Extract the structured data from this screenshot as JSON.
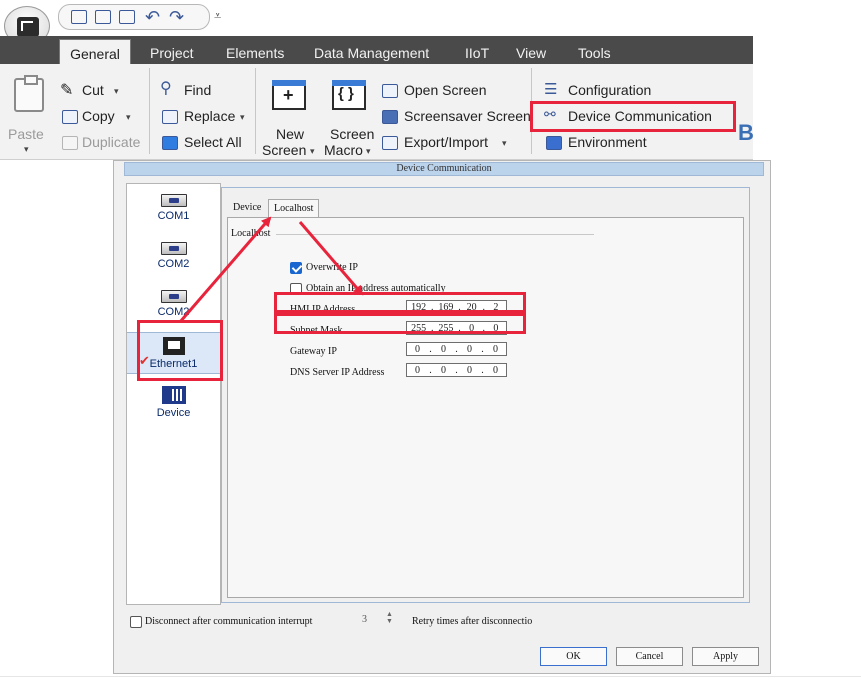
{
  "ribbon": {
    "tabs": [
      "General",
      "Project",
      "Elements",
      "Data Management",
      "IIoT",
      "View",
      "Tools"
    ],
    "active_tab": "General",
    "clipboard": {
      "paste": "Paste",
      "cut": "Cut",
      "copy": "Copy",
      "duplicate": "Duplicate"
    },
    "editing": {
      "find": "Find",
      "replace": "Replace",
      "select_all": "Select All"
    },
    "screen": {
      "new_screen_1": "New",
      "new_screen_2": "Screen",
      "screen_macro_1": "Screen",
      "screen_macro_2": "Macro",
      "open_screen": "Open Screen",
      "screensaver": "Screensaver Screen",
      "export_import": "Export/Import"
    },
    "settings": {
      "configuration": "Configuration",
      "device_communication": "Device Communication",
      "environment": "Environment"
    },
    "extra_glyph": "B",
    "caret": "▾",
    "qat_more": "⩡"
  },
  "dialog": {
    "title": "Device Communication",
    "devices": [
      {
        "label": "COM1"
      },
      {
        "label": "COM2"
      },
      {
        "label": "COM2"
      },
      {
        "label": "Ethernet1",
        "selected": true
      },
      {
        "label": "Device"
      }
    ],
    "selected_mark": "✔",
    "tabs": {
      "device": "Device",
      "localhost": "Localhost"
    },
    "section_title": "Localhost",
    "overwrite_ip": {
      "label": "Overwrite IP",
      "checked": true
    },
    "obtain_ip": {
      "label": "Obtain an IP address automatically",
      "checked": false
    },
    "fields": [
      {
        "label": "HMI IP Address",
        "octets": [
          "192",
          "169",
          "20",
          "2"
        ]
      },
      {
        "label": "Subnet Mask",
        "octets": [
          "255",
          "255",
          "0",
          "0"
        ]
      },
      {
        "label": "Gateway IP",
        "octets": [
          "0",
          "0",
          "0",
          "0"
        ]
      },
      {
        "label": "DNS Server IP Address",
        "octets": [
          "0",
          "0",
          "0",
          "0"
        ]
      }
    ],
    "ip_separator": ".",
    "disconnect": {
      "label": "Disconnect after communication interrupt",
      "checked": false
    },
    "retry_value": "3",
    "spin_up": "▲",
    "spin_down": "▼",
    "retry_label": "Retry times after disconnectio",
    "buttons": {
      "ok": "OK",
      "cancel": "Cancel",
      "apply": "Apply"
    }
  },
  "annotation_color": "#e8243c"
}
